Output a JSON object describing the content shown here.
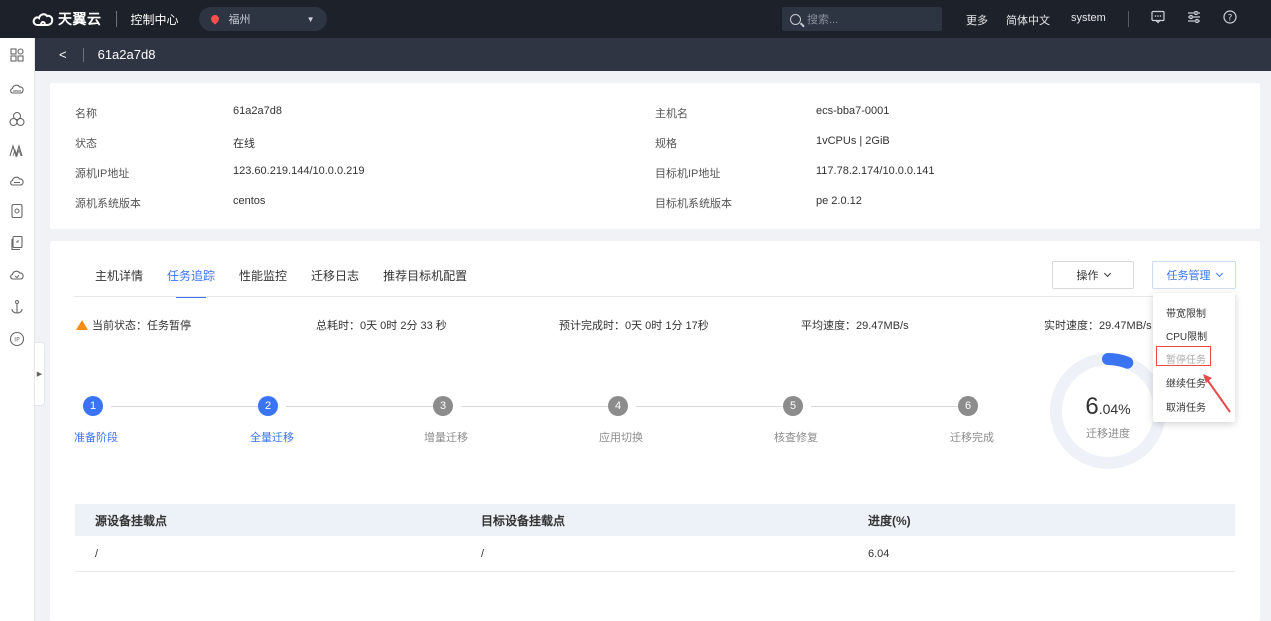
{
  "topbar": {
    "brand": "天翼云",
    "console": "控制中心",
    "region": "福州",
    "search_placeholder": "搜索...",
    "more": "更多",
    "language": "简体中文",
    "user": "system"
  },
  "titlebar": {
    "title": "61a2a7d8"
  },
  "info": {
    "left": [
      {
        "label": "名称",
        "value": "61a2a7d8"
      },
      {
        "label": "状态",
        "value": "在线"
      },
      {
        "label": "源机IP地址",
        "value": "123.60.219.144/10.0.0.219"
      },
      {
        "label": "源机系统版本",
        "value": "centos"
      }
    ],
    "right": [
      {
        "label": "主机名",
        "value": "ecs-bba7-0001"
      },
      {
        "label": "规格",
        "value": "1vCPUs | 2GiB"
      },
      {
        "label": "目标机IP地址",
        "value": "117.78.2.174/10.0.0.141"
      },
      {
        "label": "目标机系统版本",
        "value": "pe 2.0.12"
      }
    ]
  },
  "tabs": [
    "主机详情",
    "任务追踪",
    "性能监控",
    "迁移日志",
    "推荐目标机配置"
  ],
  "active_tab": 1,
  "buttons": {
    "operate": "操作",
    "task_manage": "任务管理"
  },
  "status": {
    "current": "当前状态：任务暂停",
    "elapsed": "总耗时：0天 0时 2分 33 秒",
    "eta": "预计完成时：0天 0时 1分 17秒",
    "avg_speed": "平均速度：29.47MB/s",
    "realtime_speed": "实时速度：29.47MB/s"
  },
  "steps": [
    {
      "num": "1",
      "label": "准备阶段",
      "state": "done"
    },
    {
      "num": "2",
      "label": "全量迁移",
      "state": "active"
    },
    {
      "num": "3",
      "label": "增量迁移",
      "state": "pending"
    },
    {
      "num": "4",
      "label": "应用切换",
      "state": "pending"
    },
    {
      "num": "5",
      "label": "核查修复",
      "state": "pending"
    },
    {
      "num": "6",
      "label": "迁移完成",
      "state": "pending"
    }
  ],
  "progress": {
    "percent": 6.04,
    "value_int": "6",
    "value_dec": ".04%",
    "label": "迁移进度"
  },
  "table": {
    "headers": [
      "源设备挂载点",
      "目标设备挂载点",
      "进度(%)"
    ],
    "rows": [
      [
        "/",
        "/",
        "6.04"
      ]
    ]
  },
  "dropdown": {
    "items": [
      "带宽限制",
      "CPU限制",
      "暂停任务",
      "继续任务",
      "取消任务"
    ],
    "disabled_index": 2
  },
  "colors": {
    "accent": "#3b74f3",
    "topbar": "#1d2129",
    "titlebar": "#2f3542",
    "warning": "#fa8c16",
    "highlight": "#e64a4a"
  }
}
